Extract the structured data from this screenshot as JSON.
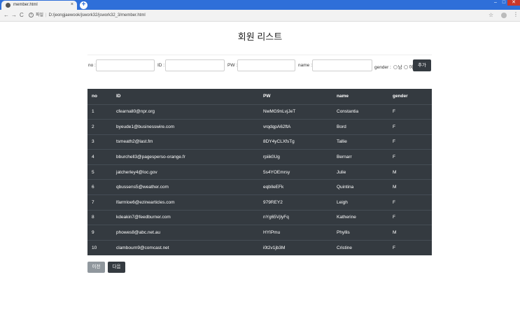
{
  "browser": {
    "tab_title": "member.html",
    "tab_close": "×",
    "new_tab": "+",
    "address_prefix": "파일",
    "address_url": "D:/jeongjaewook/jswork32/jswork32_3/member.html"
  },
  "page": {
    "title": "회원 리스트"
  },
  "form": {
    "no_label": "no :",
    "id_label": "ID :",
    "pw_label": "PW :",
    "name_label": "name :",
    "gender_label": "gender :",
    "gender_male": "남",
    "gender_female": "여",
    "add_button": "추가",
    "no_value": "",
    "id_value": "",
    "pw_value": "",
    "name_value": ""
  },
  "table": {
    "headers": [
      "no",
      "ID",
      "PW",
      "name",
      "gender"
    ],
    "rows": [
      [
        "1",
        "cfearnall0@npr.org",
        "NwMG9nLvjJeT",
        "Constantia",
        "F"
      ],
      [
        "2",
        "byeude1@businesswire.com",
        "vrqdqpA62ftA",
        "Bord",
        "F"
      ],
      [
        "3",
        "tsmeath2@last.fm",
        "8DY4yCLXfsTg",
        "Tallie",
        "F"
      ],
      [
        "4",
        "bburchell3@pagesperso-orange.fr",
        "rpiik0Ug",
        "Bernarr",
        "F"
      ],
      [
        "5",
        "jatcherley4@loc.gov",
        "5s4YOEmrsy",
        "Julie",
        "M"
      ],
      [
        "6",
        "qbussens5@weather.com",
        "eqbIleEFk",
        "Quintina",
        "M"
      ],
      [
        "7",
        "lfarmloe6@ezinearticles.com",
        "979REY2",
        "Leigh",
        "F"
      ],
      [
        "8",
        "kdeakin7@feedburner.com",
        "nYg65VjlyFq",
        "Katherine",
        "F"
      ],
      [
        "9",
        "phowes8@abc.net.au",
        "HYIPmu",
        "Phyllis",
        "M"
      ],
      [
        "10",
        "clambourn9@comcast.net",
        "i0t2v1jb3M",
        "Cristine",
        "F"
      ]
    ]
  },
  "pager": {
    "prev_label": "이전",
    "next_label": "다음"
  }
}
